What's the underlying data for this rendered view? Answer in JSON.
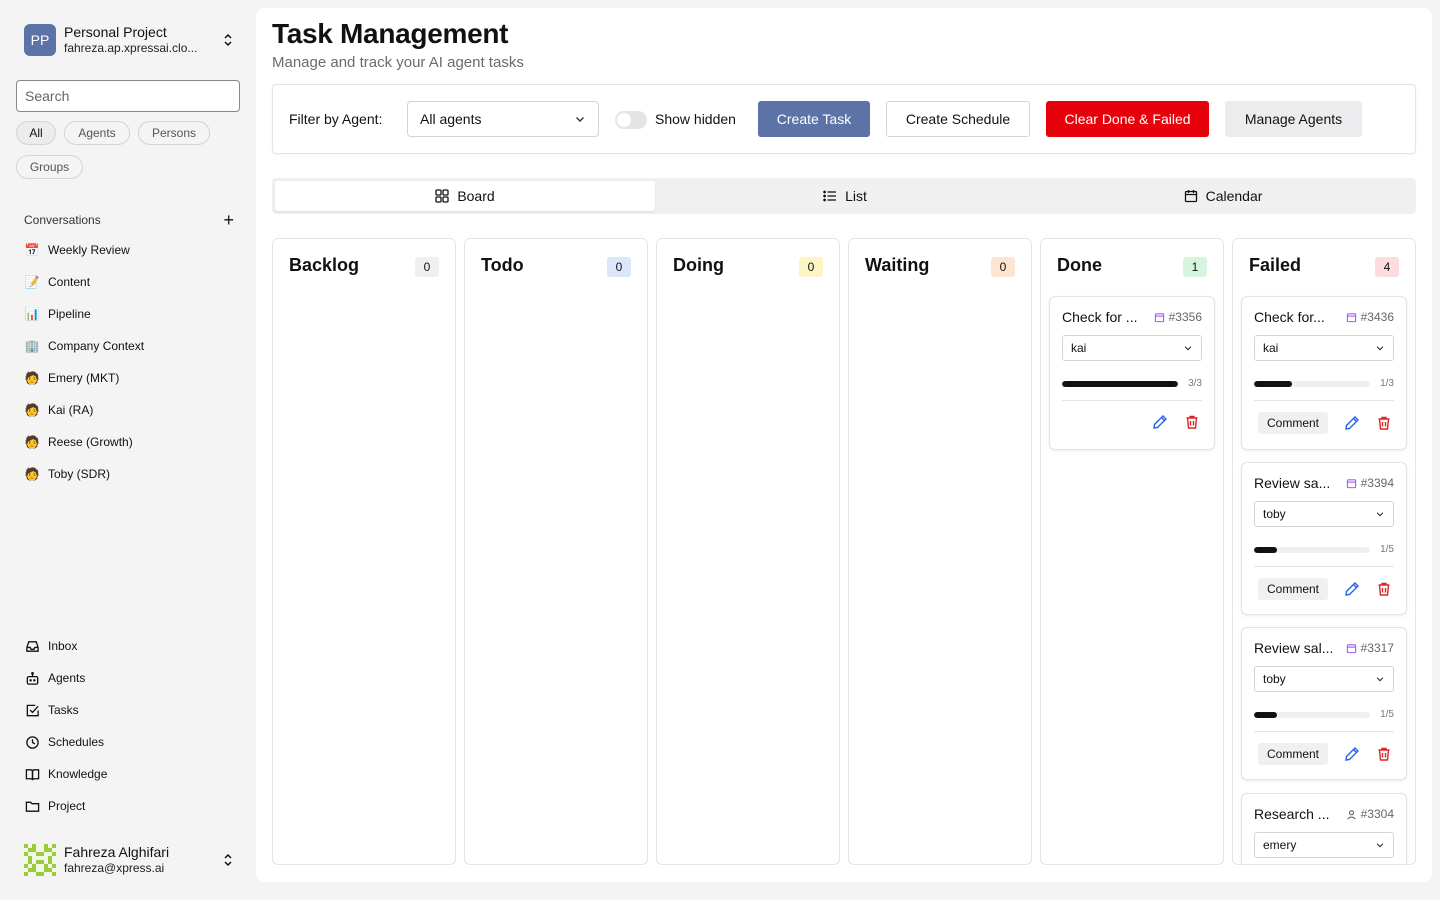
{
  "sidebar": {
    "project": {
      "initials": "PP",
      "name": "Personal Project",
      "domain": "fahreza.ap.xpressai.clo..."
    },
    "search_placeholder": "Search",
    "filters": [
      "All",
      "Agents",
      "Persons",
      "Groups"
    ],
    "conversations_label": "Conversations",
    "conversations": [
      {
        "emoji": "📅",
        "label": "Weekly Review"
      },
      {
        "emoji": "📝",
        "label": "Content"
      },
      {
        "emoji": "📊",
        "label": "Pipeline"
      },
      {
        "emoji": "🏢",
        "label": "Company Context"
      },
      {
        "emoji": "🧑",
        "label": "Emery (MKT)"
      },
      {
        "emoji": "🧑",
        "label": "Kai (RA)"
      },
      {
        "emoji": "🧑",
        "label": "Reese (Growth)"
      },
      {
        "emoji": "🧑",
        "label": "Toby (SDR)"
      }
    ],
    "nav": [
      {
        "icon": "inbox-icon",
        "label": "Inbox"
      },
      {
        "icon": "bot-icon",
        "label": "Agents"
      },
      {
        "icon": "check-square-icon",
        "label": "Tasks"
      },
      {
        "icon": "clock-icon",
        "label": "Schedules"
      },
      {
        "icon": "book-icon",
        "label": "Knowledge"
      },
      {
        "icon": "folder-icon",
        "label": "Project"
      }
    ],
    "user": {
      "name": "Fahreza Alghifari",
      "email": "fahreza@xpress.ai"
    }
  },
  "header": {
    "title": "Task Management",
    "subtitle": "Manage and track your AI agent tasks"
  },
  "toolbar": {
    "filter_label": "Filter by Agent:",
    "filter_value": "All agents",
    "show_hidden_label": "Show hidden",
    "create_task": "Create Task",
    "create_schedule": "Create Schedule",
    "clear_done_failed": "Clear Done & Failed",
    "manage_agents": "Manage Agents"
  },
  "views": [
    "Board",
    "List",
    "Calendar"
  ],
  "columns": [
    {
      "title": "Backlog",
      "count": "0",
      "badge_bg": "#f0f0f1",
      "badge_fg": "#111"
    },
    {
      "title": "Todo",
      "count": "0",
      "badge_bg": "#dbe6fb",
      "badge_fg": "#111"
    },
    {
      "title": "Doing",
      "count": "0",
      "badge_bg": "#fcf4c4",
      "badge_fg": "#111"
    },
    {
      "title": "Waiting",
      "count": "0",
      "badge_bg": "#fde6cf",
      "badge_fg": "#111"
    },
    {
      "title": "Done",
      "count": "1",
      "badge_bg": "#d6f5df",
      "badge_fg": "#111"
    },
    {
      "title": "Failed",
      "count": "4",
      "badge_bg": "#fcdcdc",
      "badge_fg": "#111"
    }
  ],
  "cards": {
    "done": [
      {
        "title": "Check for ...",
        "id": "#3356",
        "id_icon": "calendar-icon",
        "agent": "kai",
        "progress": "3/3",
        "progress_fraction": 1.0,
        "show_comment": false
      }
    ],
    "failed": [
      {
        "title": "Check for...",
        "id": "#3436",
        "id_icon": "calendar-icon",
        "agent": "kai",
        "progress": "1/3",
        "progress_fraction": 0.33,
        "comment": "Comment"
      },
      {
        "title": "Review sa...",
        "id": "#3394",
        "id_icon": "calendar-icon",
        "agent": "toby",
        "progress": "1/5",
        "progress_fraction": 0.2,
        "comment": "Comment"
      },
      {
        "title": "Review sal...",
        "id": "#3317",
        "id_icon": "calendar-icon",
        "agent": "toby",
        "progress": "1/5",
        "progress_fraction": 0.2,
        "comment": "Comment"
      },
      {
        "title": "Research ...",
        "id": "#3304",
        "id_icon": "user-icon",
        "agent": "emery"
      }
    ]
  },
  "colors": {
    "accent": "#5c73a8",
    "danger": "#e8000b",
    "edit": "#2563eb",
    "delete": "#dc2626",
    "id_calendar": "#a855f7"
  }
}
